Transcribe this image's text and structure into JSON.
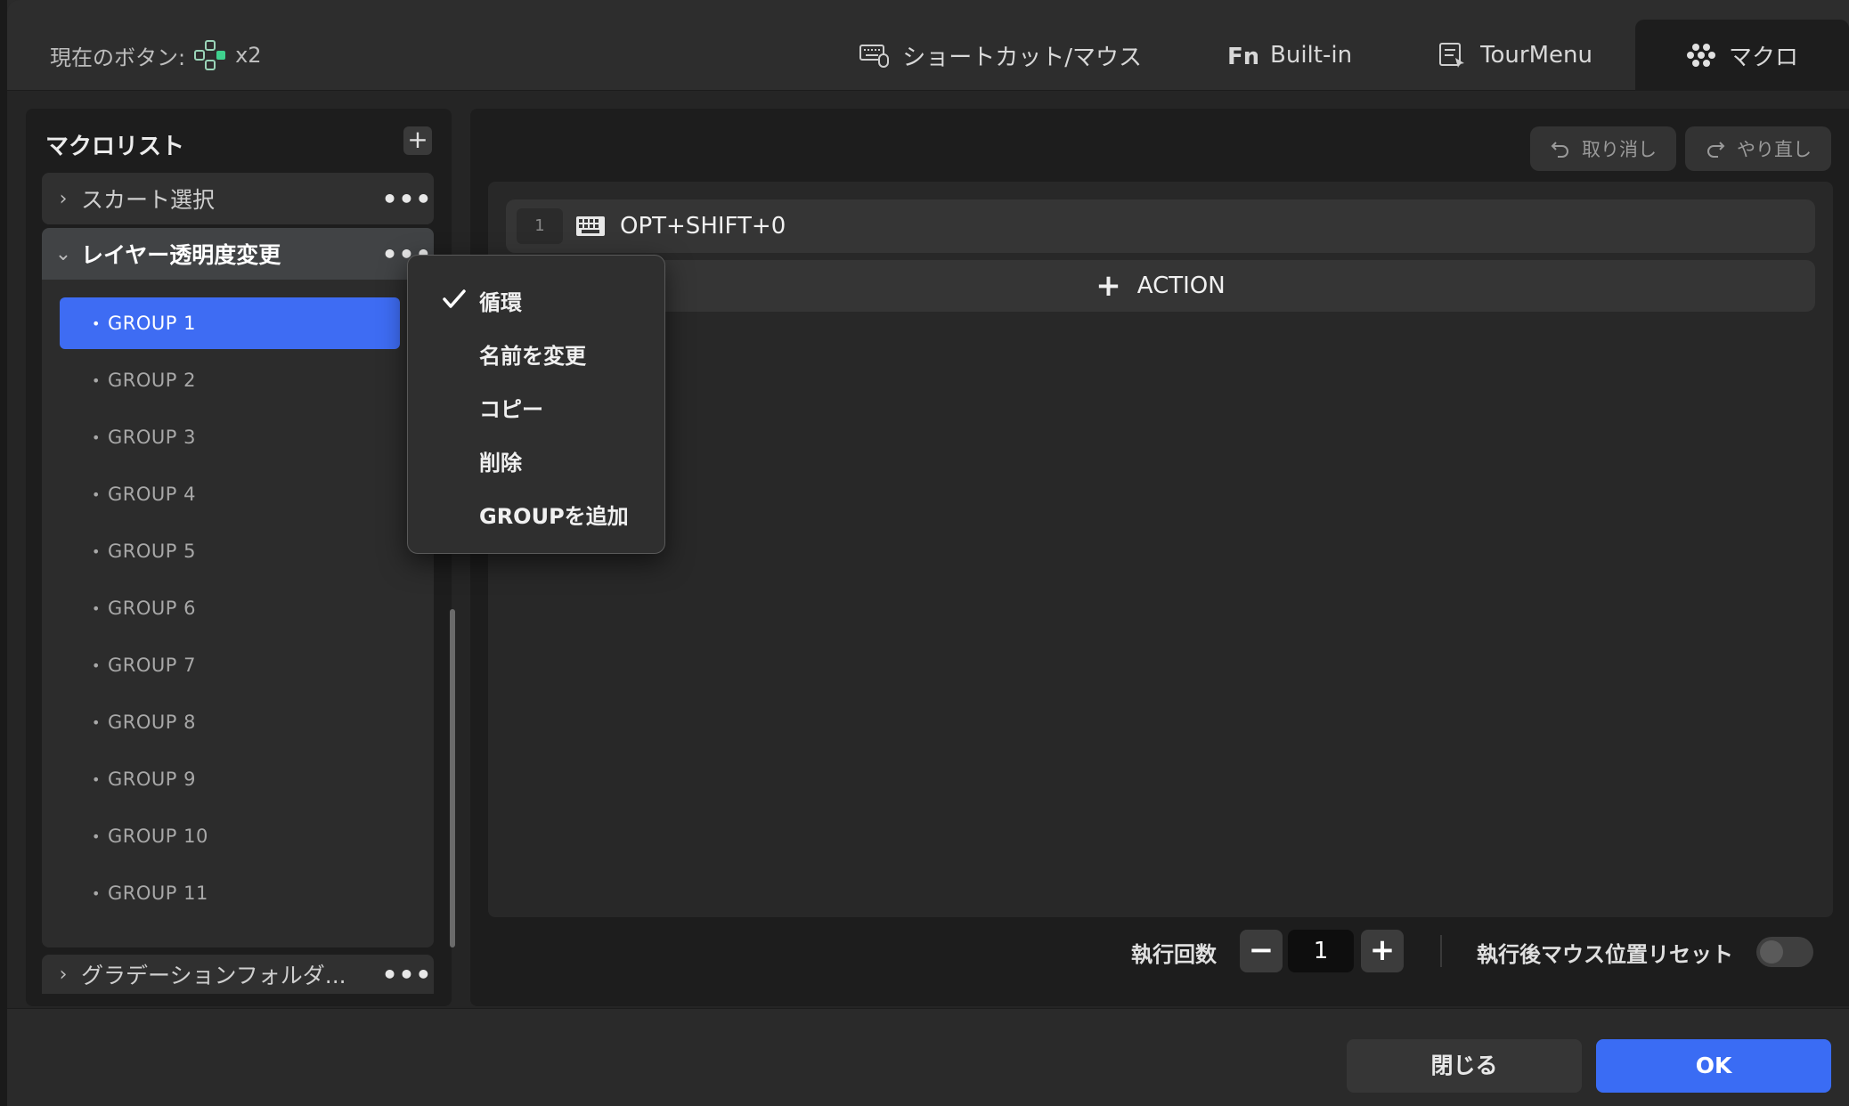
{
  "header": {
    "current_button_label": "現在のボタン:",
    "current_button_suffix": "x2",
    "tabs": [
      {
        "label": "ショートカット/マウス",
        "icon": "keyboard-mouse-icon"
      },
      {
        "label": "Built-in",
        "icon": "fn-icon"
      },
      {
        "label": "TourMenu",
        "icon": "tour-menu-icon"
      },
      {
        "label": "マクロ",
        "icon": "macro-dots-icon",
        "active": true
      }
    ]
  },
  "macro_list": {
    "title": "マクロリスト",
    "add_label": "+",
    "items": [
      {
        "name": "スカート選択",
        "expanded": false
      },
      {
        "name": "レイヤー透明度変更",
        "expanded": true
      },
      {
        "name": "グラデーションフォルダ..."
      }
    ],
    "more_label": "•••",
    "groups": [
      "GROUP 1",
      "GROUP 2",
      "GROUP 3",
      "GROUP 4",
      "GROUP 5",
      "GROUP 6",
      "GROUP 7",
      "GROUP 8",
      "GROUP 9",
      "GROUP 10",
      "GROUP 11"
    ],
    "selected_group": "GROUP 1"
  },
  "context_menu": {
    "items": [
      "循環",
      "名前を変更",
      "コピー",
      "削除",
      "GROUPを追加"
    ],
    "checked": "循環"
  },
  "editor": {
    "undo_label": "取り消し",
    "redo_label": "やり直し",
    "steps": [
      {
        "index": "1",
        "text": "OPT+SHIFT+0"
      }
    ],
    "action_label": "ACTION",
    "exec_count_label": "執行回数",
    "minus_label": "−",
    "plus_label": "+",
    "exec_count": "1",
    "mouse_reset_label": "執行後マウス位置リセット",
    "mouse_reset_on": false
  },
  "footer": {
    "close_label": "閉じる",
    "ok_label": "OK"
  },
  "colors": {
    "accent": "#3a6cf4",
    "selected_group": "#3e6cf3",
    "panel_bg": "#1d1d1d"
  }
}
